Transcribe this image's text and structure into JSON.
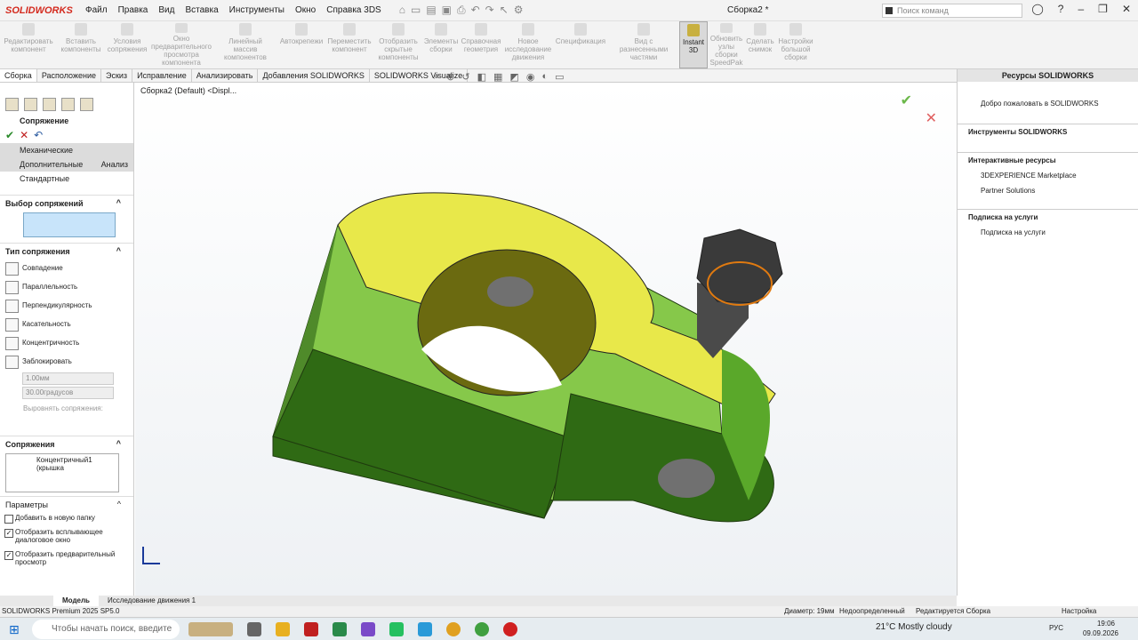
{
  "app": {
    "logo": "SOLIDWORKS",
    "doc_title": "Сборка2 *"
  },
  "menu": [
    "Файл",
    "Правка",
    "Вид",
    "Вставка",
    "Инструменты",
    "Окно",
    "Справка 3DS"
  ],
  "search": {
    "placeholder": "Поиск команд"
  },
  "ribbon": [
    "Редактировать компонент",
    "Вставить компоненты",
    "Условия сопряжения",
    "Окно предварительного просмотра компонента",
    "Линейный массив компонентов",
    "Автокрепежи",
    "Переместить компонент",
    "Отобразить скрытые компоненты",
    "Элементы сборки",
    "Справочная геометрия",
    "Новое исследование движения",
    "Спецификация",
    "Вид с разнесенными частями",
    "Instant 3D",
    "Обновить узлы сборки SpeedPak",
    "Сделать снимок",
    "Настройки большой сборки"
  ],
  "tabs": [
    "Сборка",
    "Расположение",
    "Эскиз",
    "Исправление",
    "Анализировать",
    "Добавления SOLIDWORKS",
    "SOLIDWORKS Visualize"
  ],
  "tree": {
    "root": "Сборка2 (Default) <Displ..."
  },
  "mate_panel": {
    "title": "Сопряжение",
    "categories": [
      "Механические",
      "Дополнительные",
      "Анализ",
      "Стандартные"
    ],
    "selection_header": "Выбор сопряжений",
    "type_header": "Тип сопряжения",
    "types": [
      "Совпадение",
      "Параллельность",
      "Перпендикулярность",
      "Касательность",
      "Концентричность",
      "Заблокировать"
    ],
    "distance": "1.00мм",
    "angle": "30.00градусов",
    "align_label": "Выровнять сопряжения:",
    "mates_header": "Сопряжения",
    "mates": [
      "Концентричный1 (крышка"
    ],
    "params_header": "Параметры",
    "options": [
      "Добавить в новую папку",
      "Отобразить всплывающее диалоговое окно",
      "Отобразить предварительный просмотр"
    ]
  },
  "right_panel": {
    "title": "Ресурсы SOLIDWORKS",
    "welcome": "Добро пожаловать в SOLIDWORKS",
    "tools_header": "Инструменты SOLIDWORKS",
    "interactive_header": "Интерактивные ресурсы",
    "marketplace": "3DEXPERIENCE Marketplace",
    "partners": "Partner Solutions",
    "subscription_header": "Подписка на услуги",
    "subscription": "Подписка на услуги"
  },
  "bottom_tabs": [
    "Модель",
    "Исследование движения 1"
  ],
  "status": {
    "version": "SOLIDWORKS Premium 2025 SP5.0",
    "diameter": "Диаметр: 19мм",
    "state": "Недоопределенный",
    "editing": "Редактируется Сборка",
    "settings": "Настройка"
  },
  "taskbar": {
    "search": "Чтобы начать поиск, введите",
    "weather": "21°C Mostly cloudy",
    "lang": "РУС",
    "time": "19:06",
    "date": "09.09.2026"
  },
  "colors": {
    "yellow": "#e8e84a",
    "light_green": "#86c84a",
    "dark_green": "#2f6a14",
    "bolt": "#4a4a4a",
    "accent": "#d42a1e"
  }
}
